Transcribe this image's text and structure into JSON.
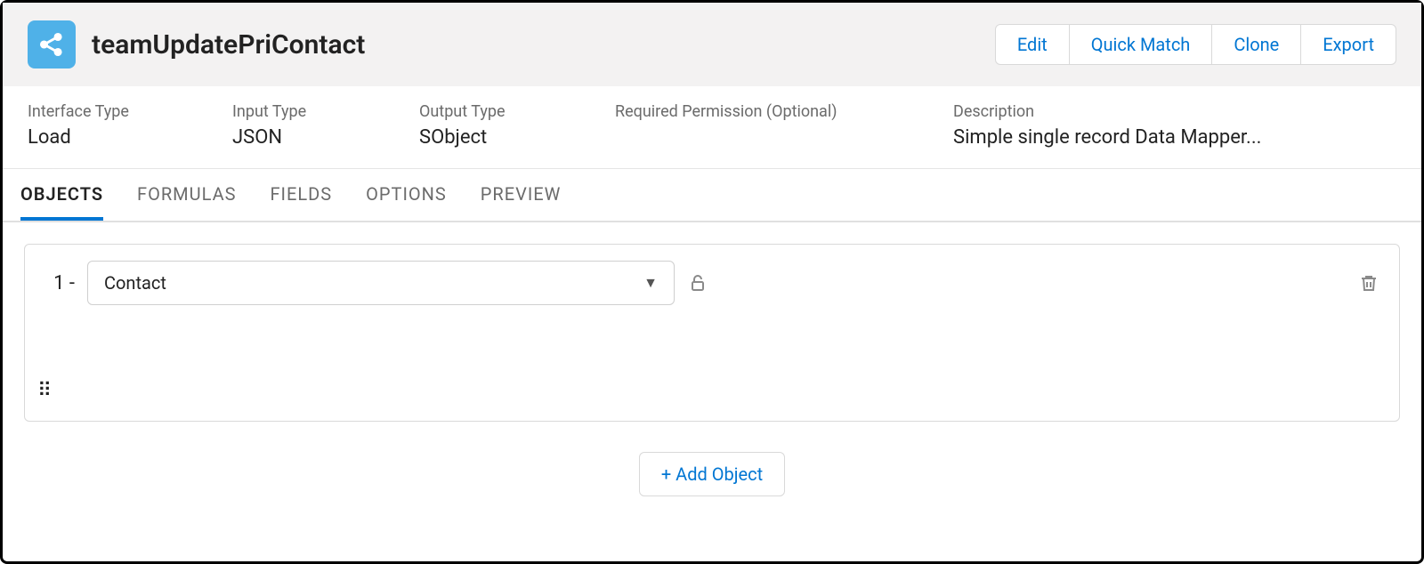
{
  "header": {
    "title": "teamUpdatePriContact",
    "icon": "share-nodes-icon",
    "actions": {
      "edit": "Edit",
      "quick_match": "Quick Match",
      "clone": "Clone",
      "export": "Export"
    }
  },
  "meta": {
    "interface_type": {
      "label": "Interface Type",
      "value": "Load"
    },
    "input_type": {
      "label": "Input Type",
      "value": "JSON"
    },
    "output_type": {
      "label": "Output Type",
      "value": "SObject"
    },
    "required_permission": {
      "label": "Required Permission (Optional)",
      "value": ""
    },
    "description": {
      "label": "Description",
      "value": "Simple single record Data Mapper..."
    }
  },
  "tabs": {
    "objects": "OBJECTS",
    "formulas": "FORMULAS",
    "fields": "FIELDS",
    "options": "OPTIONS",
    "preview": "PREVIEW"
  },
  "objects": {
    "items": [
      {
        "index": "1 -",
        "value": "Contact"
      }
    ],
    "add_label": "+ Add Object"
  }
}
